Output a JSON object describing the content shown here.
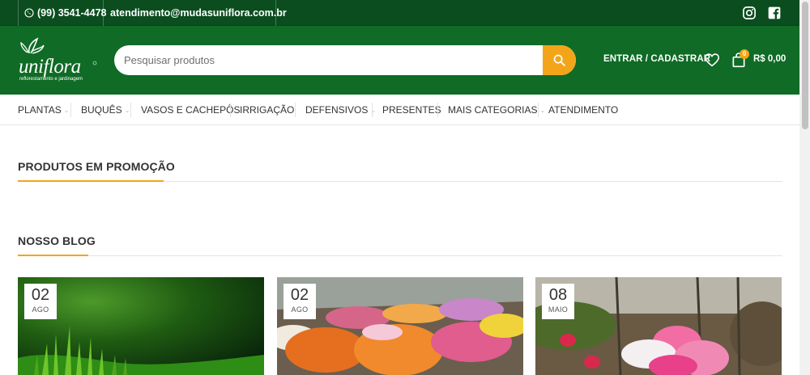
{
  "topbar": {
    "phone": "(99) 3541-4478",
    "email": "atendimento@mudasuniflora.com.br",
    "social_icons": [
      "instagram-icon",
      "facebook-icon"
    ]
  },
  "header": {
    "logo_text": "uniflora",
    "logo_tagline": "reflorestamento e jardinagem",
    "search_placeholder": "Pesquisar produtos",
    "login_label": "ENTRAR / CADASTRAR",
    "cart_count": "0",
    "cart_total": "R$ 0,00"
  },
  "nav": {
    "items": [
      {
        "label": "PLANTAS",
        "dropdown": true
      },
      {
        "label": "BUQUÊS",
        "dropdown": true
      },
      {
        "label": "VASOS E CACHEPÔS",
        "dropdown": false
      },
      {
        "label": "IRRIGAÇÃO",
        "dropdown": false
      },
      {
        "label": "DEFENSIVOS",
        "dropdown": true
      },
      {
        "label": "PRESENTES",
        "dropdown": false
      },
      {
        "label": "MAIS CATEGORIAS",
        "dropdown": true
      },
      {
        "label": "ATENDIMENTO",
        "dropdown": false
      }
    ]
  },
  "sections": {
    "promo_title": "PRODUTOS EM PROMOÇÃO",
    "blog_title": "NOSSO BLOG"
  },
  "blog": {
    "posts": [
      {
        "day": "02",
        "month": "AGO"
      },
      {
        "day": "02",
        "month": "AGO"
      },
      {
        "day": "08",
        "month": "MAIO"
      }
    ]
  },
  "colors": {
    "topbar_bg": "#0b4d1f",
    "header_bg": "#0f6b25",
    "accent": "#f3a51a"
  }
}
